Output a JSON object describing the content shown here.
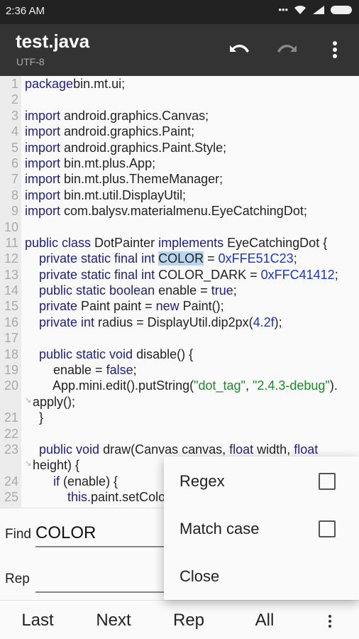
{
  "status_bar": {
    "time": "2:36  AM",
    "icons": [
      "more-dots-icon",
      "wifi-icon",
      "signal-icon",
      "battery-icon"
    ]
  },
  "toolbar": {
    "title": "test.java",
    "encoding": "UTF-8",
    "actions": [
      "undo-icon",
      "redo-icon",
      "more-vert-icon"
    ]
  },
  "editor": {
    "selection": "COLOR",
    "lines": [
      {
        "n": "1",
        "segs": [
          [
            "kw",
            "package"
          ],
          [
            "",
            "bin.mt.ui;"
          ]
        ]
      },
      {
        "n": "2",
        "segs": []
      },
      {
        "n": "3",
        "segs": [
          [
            "kw",
            "import"
          ],
          [
            "",
            " android.graphics.Canvas;"
          ]
        ]
      },
      {
        "n": "4",
        "segs": [
          [
            "kw",
            "import"
          ],
          [
            "",
            " android.graphics.Paint;"
          ]
        ]
      },
      {
        "n": "5",
        "segs": [
          [
            "kw",
            "import"
          ],
          [
            "",
            " android.graphics.Paint.Style;"
          ]
        ]
      },
      {
        "n": "6",
        "segs": [
          [
            "kw",
            "import"
          ],
          [
            "",
            " bin.mt.plus.App;"
          ]
        ]
      },
      {
        "n": "7",
        "segs": [
          [
            "kw",
            "import"
          ],
          [
            "",
            " bin.mt.plus.ThemeManager;"
          ]
        ]
      },
      {
        "n": "8",
        "segs": [
          [
            "kw",
            "import"
          ],
          [
            "",
            " bin.mt.util.DisplayUtil;"
          ]
        ]
      },
      {
        "n": "9",
        "segs": [
          [
            "kw",
            "import"
          ],
          [
            "",
            " com.balysv.materialmenu.EyeCatchingDot;"
          ]
        ]
      },
      {
        "n": "10",
        "segs": []
      },
      {
        "n": "11",
        "segs": [
          [
            "kw",
            "public class"
          ],
          [
            "",
            " DotPainter "
          ],
          [
            "kw",
            "implements"
          ],
          [
            "",
            " EyeCatchingDot {"
          ]
        ]
      },
      {
        "n": "12",
        "segs": [
          [
            "kw",
            "    private static final int"
          ],
          [
            "",
            " "
          ],
          [
            "hl",
            "COLOR"
          ],
          [
            "",
            " = "
          ],
          [
            "num",
            "0xFFE51C23"
          ],
          [
            "",
            ";"
          ]
        ]
      },
      {
        "n": "13",
        "segs": [
          [
            "kw",
            "    private static final int"
          ],
          [
            "",
            " COLOR_DARK = "
          ],
          [
            "num",
            "0xFFC41412"
          ],
          [
            "",
            ";"
          ]
        ]
      },
      {
        "n": "14",
        "segs": [
          [
            "kw",
            "    public static boolean"
          ],
          [
            "",
            " enable = "
          ],
          [
            "kw",
            "true"
          ],
          [
            "",
            ";"
          ]
        ]
      },
      {
        "n": "15",
        "segs": [
          [
            "kw",
            "    private"
          ],
          [
            "",
            " Paint paint = "
          ],
          [
            "kw",
            "new"
          ],
          [
            "",
            " Paint();"
          ]
        ]
      },
      {
        "n": "16",
        "segs": [
          [
            "kw",
            "    private int"
          ],
          [
            "",
            " radius = DisplayUtil.dip2px("
          ],
          [
            "num",
            "4.2f"
          ],
          [
            "",
            ");"
          ]
        ]
      },
      {
        "n": "17",
        "segs": []
      },
      {
        "n": "18",
        "segs": [
          [
            "kw",
            "    public static void"
          ],
          [
            "",
            " disable() {"
          ]
        ]
      },
      {
        "n": "19",
        "segs": [
          [
            "",
            "        enable = "
          ],
          [
            "kw",
            "false"
          ],
          [
            "",
            ";"
          ]
        ]
      },
      {
        "n": "20",
        "segs": [
          [
            "",
            "        App.mini.edit().putString("
          ],
          [
            "str",
            "\"dot_tag\""
          ],
          [
            "",
            ", "
          ],
          [
            "str",
            "\"2.4.3-debug\""
          ],
          [
            "",
            ")."
          ]
        ]
      },
      {
        "n": "",
        "wrap": true,
        "segs": [
          [
            "",
            "apply();"
          ]
        ]
      },
      {
        "n": "21",
        "segs": [
          [
            "",
            "    }"
          ]
        ]
      },
      {
        "n": "22",
        "segs": []
      },
      {
        "n": "23",
        "segs": [
          [
            "kw",
            "    public void"
          ],
          [
            "",
            " draw(Canvas canvas, "
          ],
          [
            "kw",
            "float"
          ],
          [
            "",
            " width, "
          ],
          [
            "kw",
            "float"
          ]
        ]
      },
      {
        "n": "",
        "wrap": true,
        "segs": [
          [
            "",
            "height) {"
          ]
        ]
      },
      {
        "n": "24",
        "segs": [
          [
            "kw",
            "        if"
          ],
          [
            "",
            " (enable) {"
          ]
        ]
      },
      {
        "n": "25",
        "segs": [
          [
            "kw",
            "            this"
          ],
          [
            "",
            ".paint.setColor"
          ]
        ]
      }
    ]
  },
  "find_panel": {
    "find_label": "Find",
    "find_value": "COLOR",
    "replace_label": "Rep",
    "replace_value": ""
  },
  "bottom_bar": {
    "buttons": [
      "Last",
      "Next",
      "Rep",
      "All"
    ],
    "more": "more-vert-icon"
  },
  "popup_menu": {
    "items": [
      {
        "label": "Regex",
        "checked": false
      },
      {
        "label": "Match case",
        "checked": false
      },
      {
        "label": "Close"
      }
    ]
  }
}
